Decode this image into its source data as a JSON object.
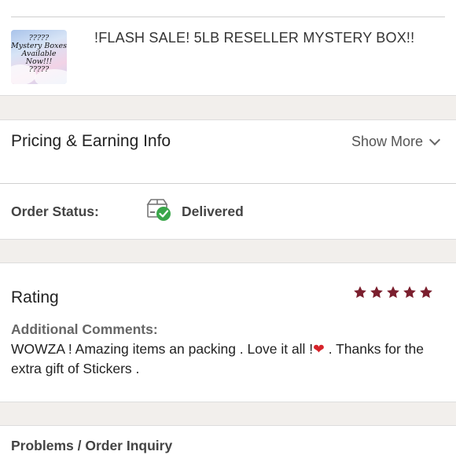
{
  "item": {
    "title": "!FLASH SALE! 5LB RESELLER MYSTERY BOX!!",
    "thumbnail_text": [
      "?????",
      "Mystery Boxes",
      "Available Now!!!",
      "?????"
    ]
  },
  "pricing": {
    "title": "Pricing & Earning Info",
    "show_more": "Show More"
  },
  "order_status": {
    "label": "Order Status:",
    "value": "Delivered",
    "icon": "delivered-box-check-icon",
    "check_color": "#3aa64a"
  },
  "rating": {
    "title": "Rating",
    "stars": 5,
    "star_color": "#7b1f2e",
    "comments_label": "Additional Comments:",
    "comments_before_heart": "WOWZA ! Amazing items an packing . Love it all !",
    "comments_heart": "❤",
    "comments_after_heart": " . Thanks for the extra gift of Stickers ."
  },
  "problems": {
    "title": "Problems / Order Inquiry"
  }
}
